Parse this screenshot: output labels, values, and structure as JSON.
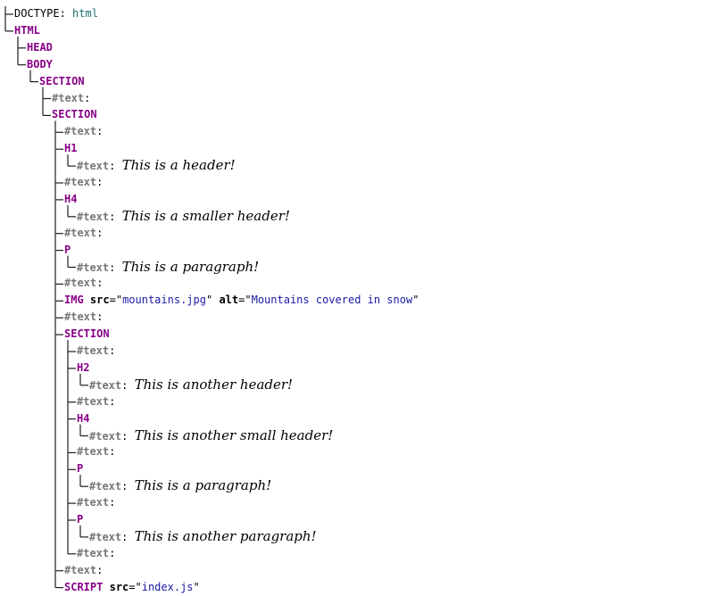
{
  "tree": {
    "nodes": [
      {
        "kind": "doctype",
        "label": "DOCTYPE",
        "value": "html",
        "depth": 0,
        "last": false
      },
      {
        "kind": "element",
        "tag": "HTML",
        "depth": 0,
        "last": true
      },
      {
        "kind": "element",
        "tag": "HEAD",
        "depth": 1,
        "last": false
      },
      {
        "kind": "element",
        "tag": "BODY",
        "depth": 1,
        "last": true
      },
      {
        "kind": "element",
        "tag": "SECTION",
        "depth": 2,
        "last": true
      },
      {
        "kind": "text",
        "label": "#text",
        "value": "",
        "depth": 3,
        "last": false
      },
      {
        "kind": "element",
        "tag": "SECTION",
        "depth": 3,
        "last": true
      },
      {
        "kind": "text",
        "label": "#text",
        "value": "",
        "depth": 4,
        "last": false
      },
      {
        "kind": "element",
        "tag": "H1",
        "depth": 4,
        "last": false
      },
      {
        "kind": "text",
        "label": "#text",
        "value": "This is a header!",
        "depth": 5,
        "last": true
      },
      {
        "kind": "text",
        "label": "#text",
        "value": "",
        "depth": 4,
        "last": false
      },
      {
        "kind": "element",
        "tag": "H4",
        "depth": 4,
        "last": false
      },
      {
        "kind": "text",
        "label": "#text",
        "value": "This is a smaller header!",
        "depth": 5,
        "last": true
      },
      {
        "kind": "text",
        "label": "#text",
        "value": "",
        "depth": 4,
        "last": false
      },
      {
        "kind": "element",
        "tag": "P",
        "depth": 4,
        "last": false
      },
      {
        "kind": "text",
        "label": "#text",
        "value": "This is a paragraph!",
        "depth": 5,
        "last": true
      },
      {
        "kind": "text",
        "label": "#text",
        "value": "",
        "depth": 4,
        "last": false
      },
      {
        "kind": "element",
        "tag": "IMG",
        "depth": 4,
        "last": false,
        "attrs": [
          {
            "name": "src",
            "value": "mountains.jpg"
          },
          {
            "name": "alt",
            "value": "Mountains covered in snow"
          }
        ]
      },
      {
        "kind": "text",
        "label": "#text",
        "value": "",
        "depth": 4,
        "last": false
      },
      {
        "kind": "element",
        "tag": "SECTION",
        "depth": 4,
        "last": false
      },
      {
        "kind": "text",
        "label": "#text",
        "value": "",
        "depth": 5,
        "last": false
      },
      {
        "kind": "element",
        "tag": "H2",
        "depth": 5,
        "last": false
      },
      {
        "kind": "text",
        "label": "#text",
        "value": "This is another header!",
        "depth": 6,
        "last": true
      },
      {
        "kind": "text",
        "label": "#text",
        "value": "",
        "depth": 5,
        "last": false
      },
      {
        "kind": "element",
        "tag": "H4",
        "depth": 5,
        "last": false
      },
      {
        "kind": "text",
        "label": "#text",
        "value": "This is another small header!",
        "depth": 6,
        "last": true
      },
      {
        "kind": "text",
        "label": "#text",
        "value": "",
        "depth": 5,
        "last": false
      },
      {
        "kind": "element",
        "tag": "P",
        "depth": 5,
        "last": false
      },
      {
        "kind": "text",
        "label": "#text",
        "value": "This is a paragraph!",
        "depth": 6,
        "last": true
      },
      {
        "kind": "text",
        "label": "#text",
        "value": "",
        "depth": 5,
        "last": false
      },
      {
        "kind": "element",
        "tag": "P",
        "depth": 5,
        "last": false
      },
      {
        "kind": "text",
        "label": "#text",
        "value": "This is another paragraph!",
        "depth": 6,
        "last": true
      },
      {
        "kind": "text",
        "label": "#text",
        "value": "",
        "depth": 5,
        "last": true
      },
      {
        "kind": "text",
        "label": "#text",
        "value": "",
        "depth": 4,
        "last": false
      },
      {
        "kind": "element",
        "tag": "SCRIPT",
        "depth": 4,
        "last": true,
        "attrs": [
          {
            "name": "src",
            "value": "index.js"
          }
        ]
      }
    ]
  },
  "colors": {
    "tag": "#880088",
    "text_label": "#777777",
    "attr_value": "#1a1aa6",
    "doctype_value": "#1a7070",
    "connector": "#1e1e1e"
  }
}
